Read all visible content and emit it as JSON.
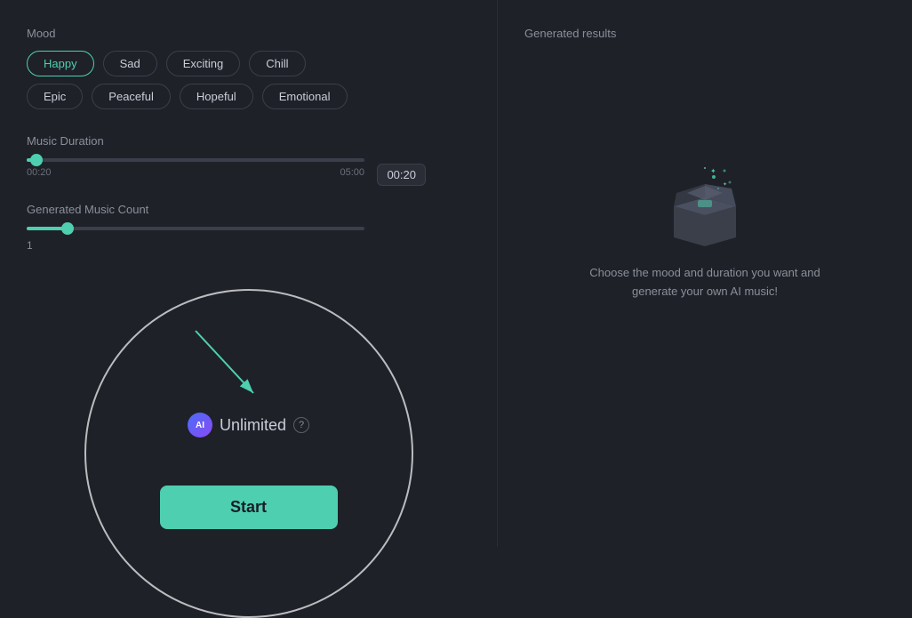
{
  "leftPanel": {
    "moodLabel": "Mood",
    "moods": [
      {
        "label": "Happy",
        "active": true
      },
      {
        "label": "Sad",
        "active": false
      },
      {
        "label": "Exciting",
        "active": false
      },
      {
        "label": "Chill",
        "active": false
      },
      {
        "label": "Epic",
        "active": false
      },
      {
        "label": "Peaceful",
        "active": false
      },
      {
        "label": "Hopeful",
        "active": false
      },
      {
        "label": "Emotional",
        "active": false
      }
    ],
    "durationLabel": "Music Duration",
    "durationMin": "00:20",
    "durationMax": "05:00",
    "durationValue": "00:20",
    "countLabel": "Generated Music Count",
    "countValue": "1",
    "unlimitedLabel": "Unlimited",
    "aiBadgeLabel": "AI",
    "questionLabel": "?",
    "startLabel": "Start"
  },
  "rightPanel": {
    "title": "Generated results",
    "emptyText": "Choose the mood and duration you want and generate your own AI music!"
  }
}
